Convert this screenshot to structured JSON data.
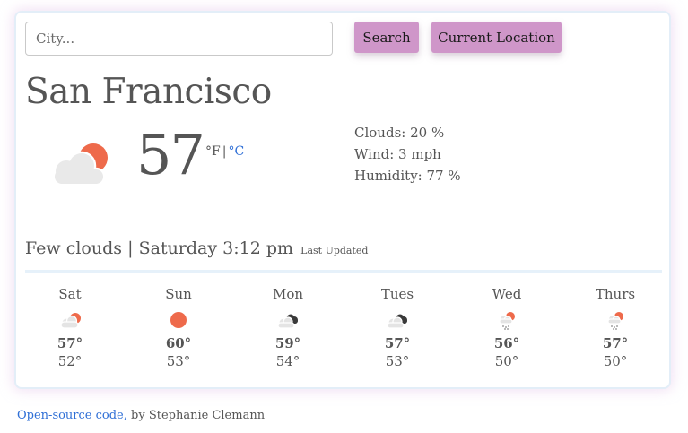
{
  "search": {
    "placeholder": "City..."
  },
  "buttons": {
    "search_label": "Search",
    "location_label": "Current Location"
  },
  "current": {
    "city": "San Francisco",
    "temperature": "57",
    "unit_f": "°F",
    "unit_sep": "|",
    "unit_c": "°C",
    "icon": "few-clouds-day-icon",
    "clouds": "Clouds: 20 %",
    "wind": "Wind: 3 mph",
    "humidity": "Humidity: 77 %",
    "description": "Few clouds",
    "separator": "|",
    "updated": "Saturday 3:12 pm",
    "last_updated_label": "Last Updated"
  },
  "forecast": [
    {
      "day": "Sat",
      "icon": "few-clouds-day-icon",
      "high": "57°",
      "low": "52°"
    },
    {
      "day": "Sun",
      "icon": "clear-sun-icon",
      "high": "60°",
      "low": "53°"
    },
    {
      "day": "Mon",
      "icon": "broken-clouds-icon",
      "high": "59°",
      "low": "54°"
    },
    {
      "day": "Tues",
      "icon": "broken-clouds-icon",
      "high": "57°",
      "low": "53°"
    },
    {
      "day": "Wed",
      "icon": "rain-sun-icon",
      "high": "56°",
      "low": "50°"
    },
    {
      "day": "Thurs",
      "icon": "rain-sun-icon",
      "high": "57°",
      "low": "50°"
    }
  ],
  "footer": {
    "link_text": "Open-source code,",
    "credit": " by Stephanie Clemann"
  },
  "colors": {
    "button": "#cf96c9",
    "link": "#2f6fd6",
    "sun": "#ee6a4b",
    "cloud": "#e9e9e9",
    "dark_cloud": "#3a3a3a",
    "divider": "#e6f1fa"
  }
}
